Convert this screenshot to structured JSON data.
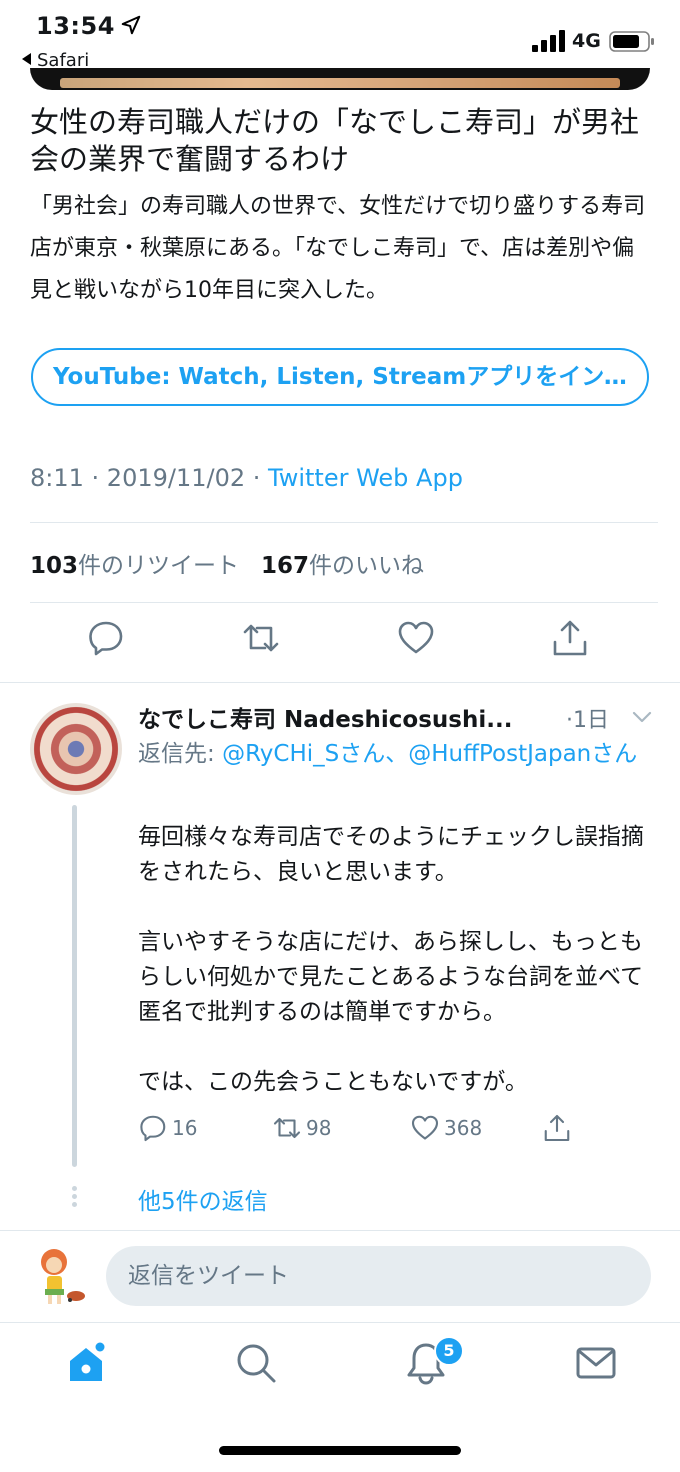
{
  "status_bar": {
    "time": "13:54",
    "back_app": "Safari",
    "network": "4G",
    "icons": [
      "location-arrow-icon",
      "signal-bars-icon",
      "battery-icon"
    ]
  },
  "tweet": {
    "card": {
      "title": "女性の寿司職人だけの「なでしこ寿司」が男社会の業界で奮闘するわけ",
      "description": "「男社会」の寿司職人の世界で、女性だけで切り盛りする寿司店が東京・秋葉原にある。「なでしこ寿司」で、店は差別や偏見と戦いながら10年目に突入した。",
      "app_button": "YouTube: Watch, Listen, Streamアプリをインストール"
    },
    "time": "8:11",
    "date": "2019/11/02",
    "separator": " · ",
    "source": "Twitter Web App",
    "retweet_count": "103",
    "retweet_label": "件のリツイート",
    "like_count": "167",
    "like_label": "件のいいね",
    "action_icons": [
      "reply-icon",
      "retweet-icon",
      "like-icon",
      "share-icon"
    ]
  },
  "reply": {
    "name": "なでしこ寿司 Nadeshicosushi...",
    "time": "·1日",
    "reply_prefix": "返信先: ",
    "reply_to_1": "@RyCHi_Sさん",
    "reply_sep": "、",
    "reply_to_2": "@HuffPostJapanさん",
    "paragraphs": [
      "毎回様々な寿司店でそのようにチェックし誤指摘をされたら、良いと思います。",
      "言いやすそうな店にだけ、あら探しし、もっともらしい何処かで見たことあるような台詞を並べて匿名で批判するのは簡単ですから。",
      "では、この先会うこともないですが。"
    ],
    "reply_count": "16",
    "retweet_count": "98",
    "like_count": "368",
    "more_replies": "他5件の返信"
  },
  "compose": {
    "placeholder": "返信をツイート"
  },
  "tabbar": {
    "tabs": [
      "home-icon",
      "search-icon",
      "notifications-icon",
      "messages-icon"
    ],
    "notification_badge": "5"
  },
  "colors": {
    "accent": "#1da1f2",
    "muted": "#657786",
    "text": "#14171a",
    "divider": "#e1e8ed"
  }
}
